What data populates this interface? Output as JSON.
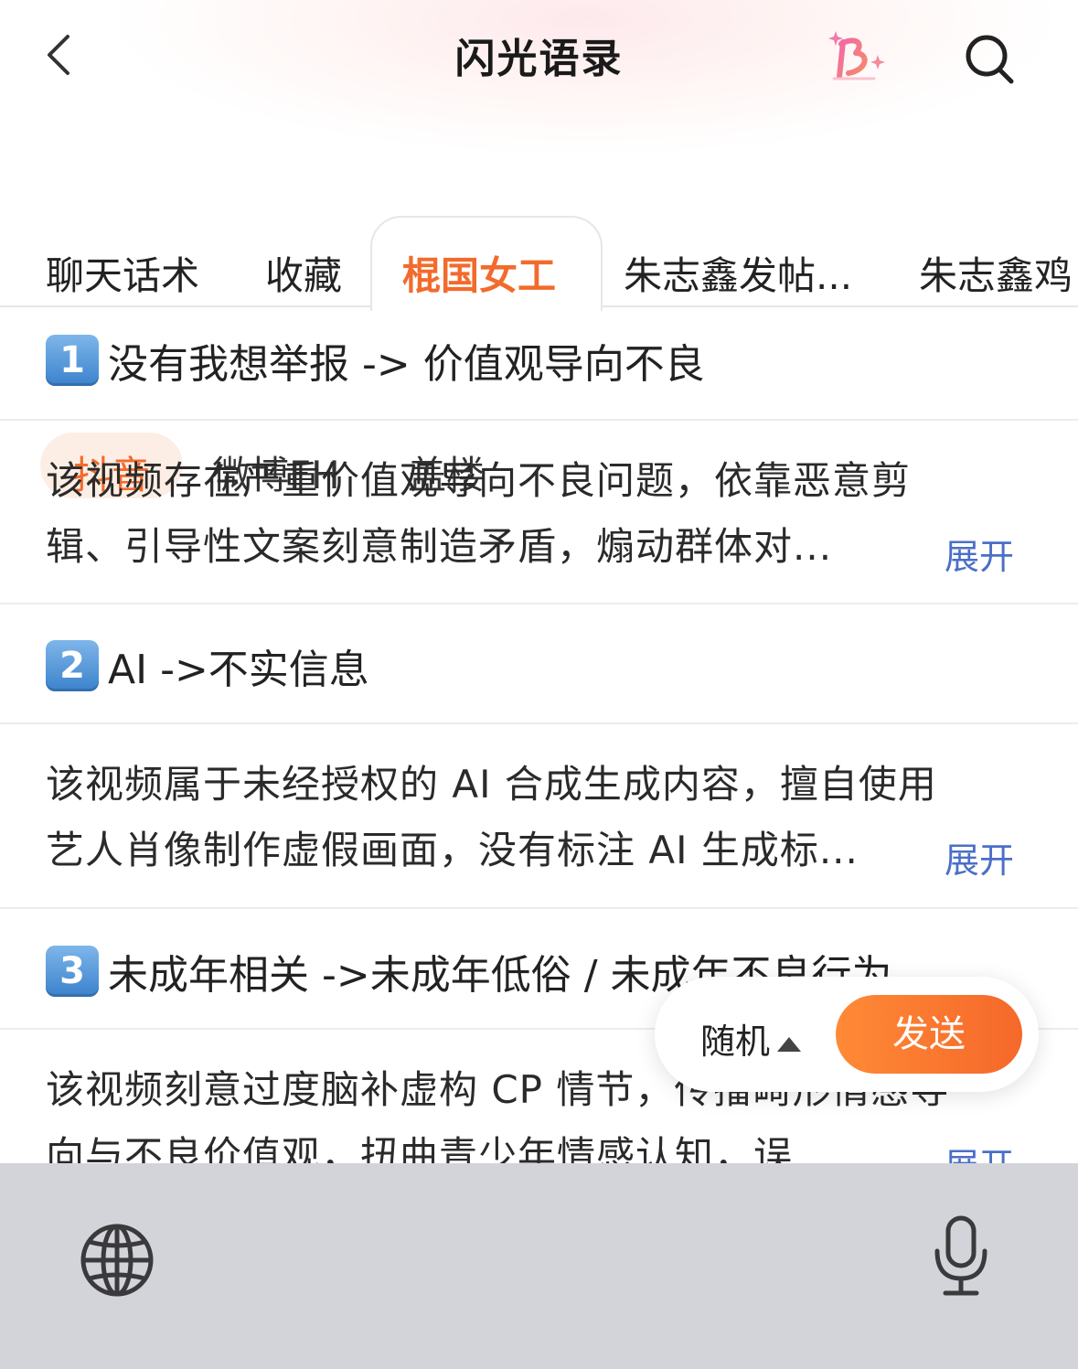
{
  "header": {
    "title": "闪光语录"
  },
  "tabs": [
    {
      "label": "聊天话术"
    },
    {
      "label": "收藏"
    },
    {
      "label": "棍国女工",
      "active": true
    },
    {
      "label": "朱志鑫发帖..."
    },
    {
      "label": "朱志鑫鸡"
    }
  ],
  "subtabs": [
    {
      "label": "抖音",
      "active": true
    },
    {
      "label": "微博FH"
    },
    {
      "label": "盖楼"
    }
  ],
  "items": [
    {
      "number": "1",
      "title": "没有我想举报 -> 价值观导向不良",
      "body_line1": "该视频存在严重价值观导向不良问题，依靠恶意剪",
      "body_line2": "辑、引导性文案刻意制造矛盾，煽动群体对...",
      "expand": "展开"
    },
    {
      "number": "2",
      "title": "AI ->不实信息",
      "body_line1": "该视频属于未经授权的 AI 合成生成内容，擅自使用",
      "body_line2": "艺人肖像制作虚假画面，没有标注 AI 生成标...",
      "expand": "展开"
    },
    {
      "number": "3",
      "title": "未成年相关 ->未成年低俗 / 未成年不良行为",
      "body_line1": "该视频刻意过度脑补虚构 CP 情节，传播畸形情感导",
      "body_line2": "向与不良价值观，扭曲青少年情感认知，误",
      "expand": "展开"
    }
  ],
  "actions": {
    "random_label": "随机",
    "send_label": "发送"
  },
  "colors": {
    "accent": "#f26b2c",
    "link": "#4a6fc6",
    "keyboard_bg": "#d3d4d9"
  },
  "icons": {
    "back": "chevron-left-icon",
    "badge": "b-sparkle-icon",
    "search": "search-icon",
    "globe": "globe-icon",
    "mic": "microphone-icon"
  }
}
